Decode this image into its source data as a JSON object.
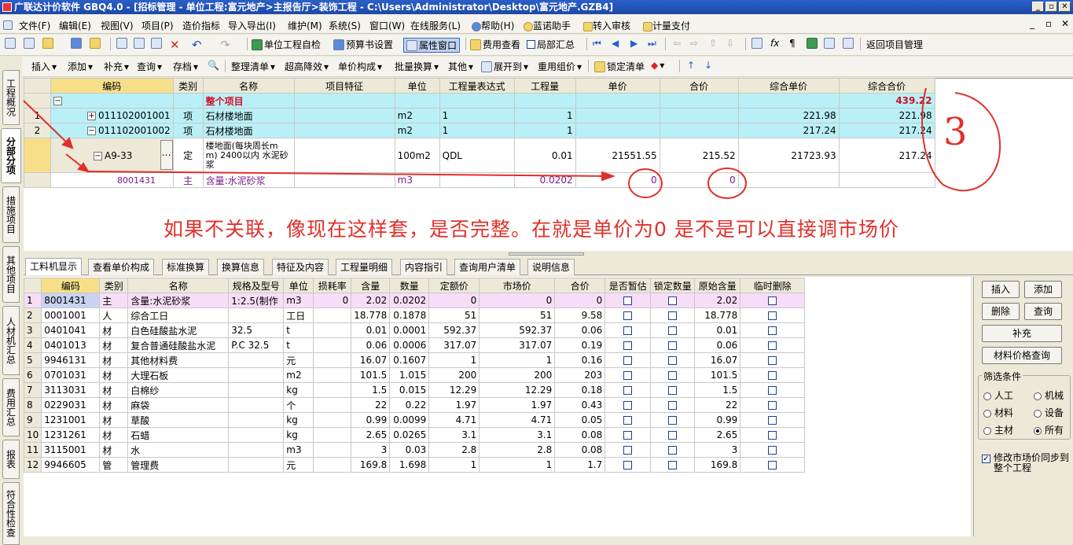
{
  "title": "广联达计价软件 GBQ4.0 - [招标管理 - 单位工程:富元地产>主报告厅>装饰工程 - C:\\Users\\Administrator\\Desktop\\富元地产.GZB4]",
  "window_buttons": [
    "_",
    "▫",
    "✕"
  ],
  "mdi_buttons": [
    "_",
    "▫",
    "✕"
  ],
  "menu": [
    "文件(F)",
    "编辑(E)",
    "视图(V)",
    "项目(P)",
    "造价指标",
    "导入导出(I)",
    "维护(M)",
    "系统(S)",
    "窗口(W)",
    "在线服务(L)",
    "帮助(H)",
    "蓝诺助手",
    "转入审核",
    "计量支付"
  ],
  "toolbar1": {
    "self_check": "单位工程自检",
    "budget_setting": "预算书设置",
    "attr_window": "属性窗口",
    "fee_view": "费用查看",
    "partial_summary": "局部汇总",
    "return_mgmt": "返回项目管理"
  },
  "toolbar2": {
    "insert": "插入",
    "add": "添加",
    "supplement": "补充",
    "query": "查询",
    "save": "存档",
    "organize": "整理清单",
    "super_height": "超高降效",
    "unit_price": "单价构成",
    "batch": "批量换算",
    "other": "其他",
    "expand": "展开到",
    "reuse": "重用组价",
    "lock": "锁定清单"
  },
  "left_tabs": [
    "工程概况",
    "分部分项",
    "措施项目",
    "其他项目",
    "人材机汇总",
    "费用汇总",
    "报表",
    "符合性检查"
  ],
  "top_grid": {
    "headers": [
      "",
      "编码",
      "类别",
      "名称",
      "项目特征",
      "单位",
      "工程量表达式",
      "工程量",
      "单价",
      "合价",
      "综合单价",
      "综合合价"
    ],
    "rows": [
      {
        "no": "",
        "code": "",
        "type": "",
        "name": "整个项目",
        "feature": "",
        "unit": "",
        "expr": "",
        "qty": "",
        "price": "",
        "total": "",
        "comp_price": "",
        "comp_total": "439.22"
      },
      {
        "no": "1",
        "code": "011102001001",
        "type": "项",
        "name": "石材楼地面",
        "feature": "",
        "unit": "m2",
        "expr": "1",
        "qty": "1",
        "price": "",
        "total": "",
        "comp_price": "221.98",
        "comp_total": "221.98"
      },
      {
        "no": "2",
        "code": "011102001002",
        "type": "项",
        "name": "石材楼地面",
        "feature": "",
        "unit": "m2",
        "expr": "1",
        "qty": "1",
        "price": "",
        "total": "",
        "comp_price": "217.24",
        "comp_total": "217.24"
      },
      {
        "no": "",
        "code": "A9-33",
        "type": "定",
        "name": "楼地面(每块周长m m) 2400以内 水泥砂浆",
        "feature": "",
        "unit": "100m2",
        "expr": "QDL",
        "qty": "0.01",
        "price": "21551.55",
        "total": "215.52",
        "comp_price": "21723.93",
        "comp_total": "217.24"
      },
      {
        "no": "",
        "code": "8001431",
        "type": "主",
        "name": "含量:水泥砂浆",
        "feature": "",
        "unit": "m3",
        "expr": "",
        "qty": "0.0202",
        "price": "0",
        "total": "0",
        "comp_price": "",
        "comp_total": ""
      }
    ]
  },
  "annotation": {
    "text": "如果不关联，像现在这样套，是否完整。在就是单价为0   是不是可以直接调市场价",
    "number": "3"
  },
  "bottom_tabs": [
    "工料机显示",
    "查看单价构成",
    "标准换算",
    "换算信息",
    "特征及内容",
    "工程量明细",
    "内容指引",
    "查询用户清单",
    "说明信息"
  ],
  "bottom_grid": {
    "headers": [
      "",
      "编码",
      "类别",
      "名称",
      "规格及型号",
      "单位",
      "损耗率",
      "含量",
      "数量",
      "定额价",
      "市场价",
      "合价",
      "是否暂估",
      "锁定数量",
      "原始含量",
      "临时删除"
    ],
    "rows": [
      [
        "1",
        "8001431",
        "主",
        "含量:水泥砂浆",
        "1:2.5(制作",
        "m3",
        "0",
        "2.02",
        "0.0202",
        "0",
        "0",
        "0",
        "",
        "",
        "2.02",
        ""
      ],
      [
        "2",
        "0001001",
        "人",
        "综合工日",
        "",
        "工日",
        "",
        "18.778",
        "0.1878",
        "51",
        "51",
        "9.58",
        "",
        "",
        "18.778",
        ""
      ],
      [
        "3",
        "0401041",
        "材",
        "白色硅酸盐水泥",
        "32.5",
        "t",
        "",
        "0.01",
        "0.0001",
        "592.37",
        "592.37",
        "0.06",
        "",
        "",
        "0.01",
        ""
      ],
      [
        "4",
        "0401013",
        "材",
        "复合普通硅酸盐水泥",
        "P.C 32.5",
        "t",
        "",
        "0.06",
        "0.0006",
        "317.07",
        "317.07",
        "0.19",
        "",
        "",
        "0.06",
        ""
      ],
      [
        "5",
        "9946131",
        "材",
        "其他材料费",
        "",
        "元",
        "",
        "16.07",
        "0.1607",
        "1",
        "1",
        "0.16",
        "",
        "",
        "16.07",
        ""
      ],
      [
        "6",
        "0701031",
        "材",
        "大理石板",
        "",
        "m2",
        "",
        "101.5",
        "1.015",
        "200",
        "200",
        "203",
        "",
        "",
        "101.5",
        ""
      ],
      [
        "7",
        "3113031",
        "材",
        "白棉纱",
        "",
        "kg",
        "",
        "1.5",
        "0.015",
        "12.29",
        "12.29",
        "0.18",
        "",
        "",
        "1.5",
        ""
      ],
      [
        "8",
        "0229031",
        "材",
        "麻袋",
        "",
        "个",
        "",
        "22",
        "0.22",
        "1.97",
        "1.97",
        "0.43",
        "",
        "",
        "22",
        ""
      ],
      [
        "9",
        "1231001",
        "材",
        "草酸",
        "",
        "kg",
        "",
        "0.99",
        "0.0099",
        "4.71",
        "4.71",
        "0.05",
        "",
        "",
        "0.99",
        ""
      ],
      [
        "10",
        "1231261",
        "材",
        "石蜡",
        "",
        "kg",
        "",
        "2.65",
        "0.0265",
        "3.1",
        "3.1",
        "0.08",
        "",
        "",
        "2.65",
        ""
      ],
      [
        "11",
        "3115001",
        "材",
        "水",
        "",
        "m3",
        "",
        "3",
        "0.03",
        "2.8",
        "2.8",
        "0.08",
        "",
        "",
        "3",
        ""
      ],
      [
        "12",
        "9946605",
        "管",
        "管理费",
        "",
        "元",
        "",
        "169.8",
        "1.698",
        "1",
        "1",
        "1.7",
        "",
        "",
        "169.8",
        ""
      ]
    ]
  },
  "right_panel": {
    "insert": "插入",
    "add": "添加",
    "delete": "删除",
    "query": "查询",
    "supplement": "补充",
    "price_query": "材料价格查询",
    "filter_title": "筛选条件",
    "filters": [
      {
        "label": "人工",
        "checked": false
      },
      {
        "label": "机械",
        "checked": false
      },
      {
        "label": "材料",
        "checked": false
      },
      {
        "label": "设备",
        "checked": false
      },
      {
        "label": "主材",
        "checked": false
      },
      {
        "label": "所有",
        "checked": true
      }
    ],
    "sync_label": "修改市场价同步到整个工程",
    "sync_checked": true
  }
}
